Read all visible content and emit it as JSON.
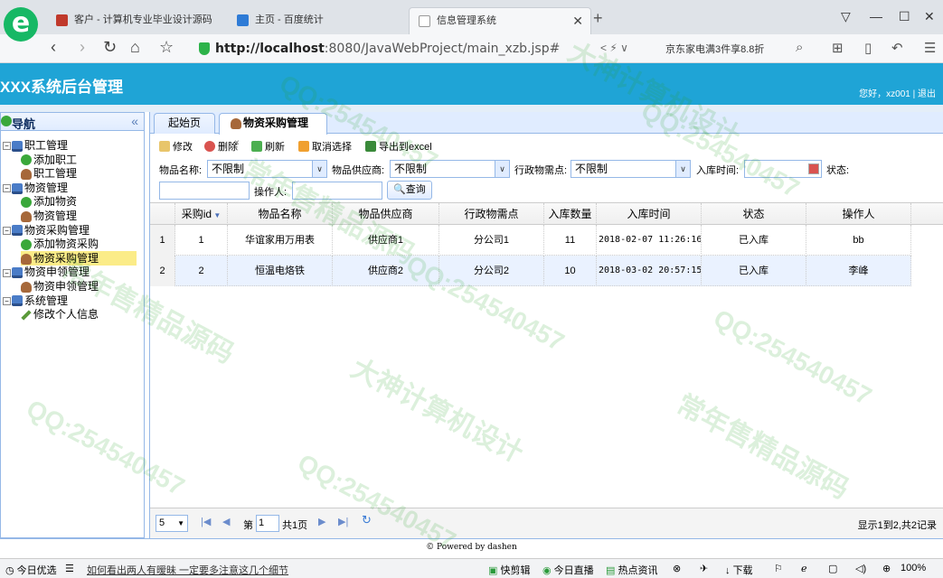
{
  "browser": {
    "tabs": [
      {
        "label": "客户 - 计算机专业毕业设计源码",
        "favicon_color": "#c0392b"
      },
      {
        "label": "主页 - 百度统计",
        "favicon_color": "#2e7bd6"
      },
      {
        "label": "信息管理系统",
        "favicon_color": "#aaaaaa",
        "active": true
      }
    ],
    "url_host": "http://localhost",
    "url_rest": ":8080/JavaWebProject/main_xzb.jsp#",
    "promo": "京东家电满3件享8.8折"
  },
  "header": {
    "title": "XXX系统后台管理",
    "user_info": "您好，xz001 | 退出"
  },
  "sidebar": {
    "title": "导航",
    "collapse_glyph": "«",
    "nodes": [
      {
        "label": "职工管理",
        "level": 0
      },
      {
        "label": "添加职工",
        "level": 1,
        "icon": "add"
      },
      {
        "label": "职工管理",
        "level": 1,
        "icon": "user"
      },
      {
        "label": "物资管理",
        "level": 0
      },
      {
        "label": "添加物资",
        "level": 1,
        "icon": "add"
      },
      {
        "label": "物资管理",
        "level": 1,
        "icon": "user"
      },
      {
        "label": "物资采购管理",
        "level": 0
      },
      {
        "label": "添加物资采购",
        "level": 1,
        "icon": "add"
      },
      {
        "label": "物资采购管理",
        "level": 1,
        "icon": "user",
        "selected": true
      },
      {
        "label": "物资申领管理",
        "level": 0
      },
      {
        "label": "物资申领管理",
        "level": 1,
        "icon": "user"
      },
      {
        "label": "系统管理",
        "level": 0
      },
      {
        "label": "修改个人信息",
        "level": 1,
        "icon": "pen"
      }
    ]
  },
  "tabs": {
    "home": "起始页",
    "active": "物资采购管理",
    "close": "×"
  },
  "toolbar": {
    "edit": "修改",
    "delete": "删除",
    "refresh": "刷新",
    "cancel_select": "取消选择",
    "export": "导出到excel"
  },
  "search": {
    "goods_name_label": "物品名称:",
    "goods_name_value": "不限制",
    "supplier_label": "物品供应商:",
    "supplier_value": "不限制",
    "dept_label": "行政物需点:",
    "dept_value": "不限制",
    "in_time_label": "入库时间:",
    "status_label": "状态:",
    "operator_label": "操作人:",
    "query_button": "查询"
  },
  "grid": {
    "columns": [
      "采购id",
      "物品名称",
      "物品供应商",
      "行政物需点",
      "入库数量",
      "入库时间",
      "状态",
      "操作人"
    ],
    "rows": [
      {
        "num": "1",
        "id": "1",
        "name": "华谊家用万用表",
        "supplier": "供应商1",
        "dept": "分公司1",
        "qty": "11",
        "time": "2018-02-07 11:26:16",
        "status": "已入库",
        "operator": "bb"
      },
      {
        "num": "2",
        "id": "2",
        "name": "恒温电烙铁",
        "supplier": "供应商2",
        "dept": "分公司2",
        "qty": "10",
        "time": "2018-03-02 20:57:15",
        "status": "已入库",
        "operator": "李峰"
      }
    ]
  },
  "pager": {
    "page_size": "5",
    "page_prefix": "第",
    "page_value": "1",
    "page_total": "共1页",
    "info": "显示1到2,共2记录"
  },
  "footer": "© Powered by dashen",
  "statusbar": {
    "left": "今日优选",
    "news": "如何看出两人有暧昧 一定要多注意这几个细节",
    "kuaijian": "快剪辑",
    "live": "今日直播",
    "hot": "热点资讯",
    "download": "下载",
    "zoom": "100%"
  },
  "watermarks": [
    "QQ:254540457",
    "大神计算机设计",
    "常年售精品源码"
  ]
}
